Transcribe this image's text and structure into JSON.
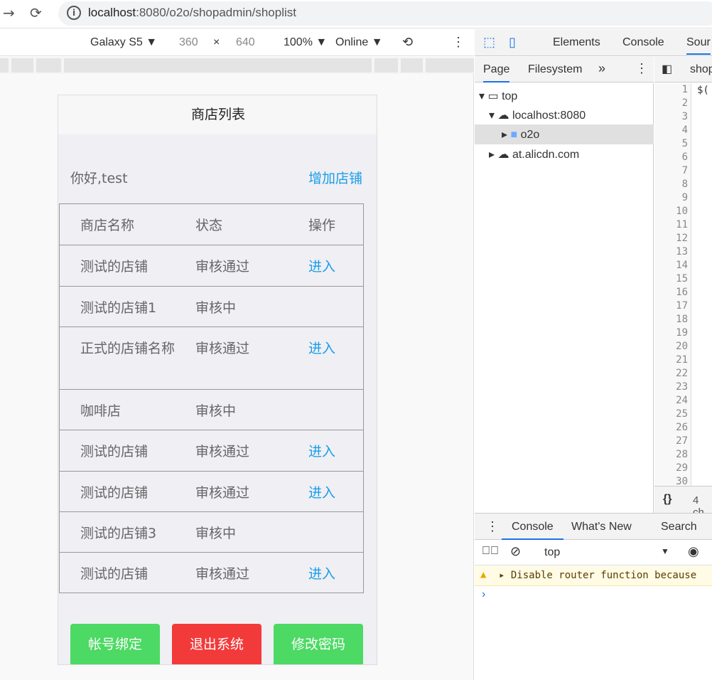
{
  "browser": {
    "url_host": "localhost",
    "url_rest": ":8080/o2o/shopadmin/shoplist"
  },
  "device_toolbar": {
    "device": "Galaxy S5",
    "width": "360",
    "times": "×",
    "height": "640",
    "zoom": "100%",
    "network": "Online"
  },
  "page": {
    "title": "商店列表",
    "greeting": "你好,test",
    "add_shop": "增加店铺",
    "table": {
      "headers": [
        "商店名称",
        "状态",
        "操作"
      ],
      "rows": [
        {
          "name": "测试的店铺",
          "status": "审核通过",
          "action": "进入"
        },
        {
          "name": "测试的店铺1",
          "status": "审核中",
          "action": ""
        },
        {
          "name": "正式的店铺名称",
          "status": "审核通过",
          "action": "进入"
        },
        {
          "name": "咖啡店",
          "status": "审核中",
          "action": ""
        },
        {
          "name": "测试的店铺",
          "status": "审核通过",
          "action": "进入"
        },
        {
          "name": "测试的店铺",
          "status": "审核通过",
          "action": "进入"
        },
        {
          "name": "测试的店铺3",
          "status": "审核中",
          "action": ""
        },
        {
          "name": "测试的店铺",
          "status": "审核通过",
          "action": "进入"
        }
      ]
    },
    "buttons": {
      "bind": "帐号绑定",
      "logout": "退出系统",
      "change_pw": "修改密码"
    },
    "colors": {
      "link": "#1a9ee8",
      "green": "#4cd964",
      "red": "#f23a3a"
    }
  },
  "devtools": {
    "tabs": [
      "Elements",
      "Console",
      "Sour"
    ],
    "nav_tabs": [
      "Page",
      "Filesystem"
    ],
    "tree": [
      "top",
      "localhost:8080",
      "o2o",
      "at.alicdn.com"
    ],
    "editor_tab": "shop",
    "code_line1": "$(",
    "line_numbers": [
      "1",
      "2",
      "3",
      "4",
      "5",
      "6",
      "7",
      "8",
      "9",
      "10",
      "11",
      "12",
      "13",
      "14",
      "15",
      "16",
      "17",
      "18",
      "19",
      "20",
      "21",
      "22",
      "23",
      "24",
      "25",
      "26",
      "27",
      "28",
      "29",
      "30"
    ],
    "status_text": "4 ch",
    "drawer_tabs": [
      "Console",
      "What's New",
      "Search"
    ],
    "context": "top",
    "warning": "Disable router function because"
  }
}
